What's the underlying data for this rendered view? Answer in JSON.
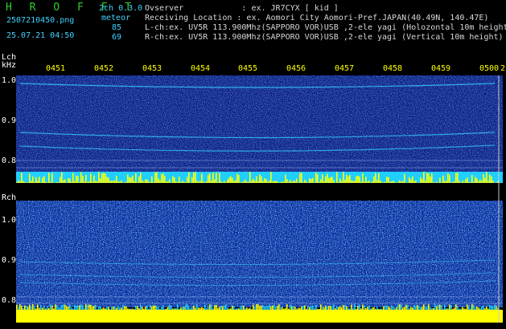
{
  "header": {
    "logo": "H R O F F T",
    "filename": "2507210450.png",
    "datetime": "25.07.21 04:50",
    "mode": "2ch 0.3.0",
    "meteor_label": "meteor",
    "count_l": "85",
    "count_r": "69",
    "observer": "Ovserver            : ex. JR7CYX [ kid ]",
    "location": "Receiving Location : ex. Aomori City Aomori-Pref.JAPAN(40.49N, 140.47E)",
    "lch_info": "L-ch:ex. UV5R 113.900Mhz(SAPPORO VOR)USB ,2-ele yagi (Holozontal 10m height",
    "rch_info": "R-ch:ex. UV5R 113.900Mhz(SAPPORO VOR)USB ,2-ele yagi (Vertical 10m height)"
  },
  "lch": {
    "label": "Lch",
    "unit": "kHz",
    "yticks": [
      "1.0",
      "0.9",
      "0.8"
    ],
    "time_ticks": [
      "0451",
      "0452",
      "0453",
      "0454",
      "0455",
      "0456",
      "0457",
      "0458",
      "0459",
      "0500"
    ],
    "edge_tick": "2"
  },
  "rch": {
    "label": "Rch",
    "yticks": [
      "1.0",
      "0.9",
      "0.8"
    ]
  },
  "colors": {
    "background": "#000000",
    "spectrogram_base": "#0b1a78",
    "signal": "#38d0ff",
    "activity_bar": "#ffff00",
    "text_header": "#2fcf2f",
    "text_cyan": "#3fd2ff"
  }
}
